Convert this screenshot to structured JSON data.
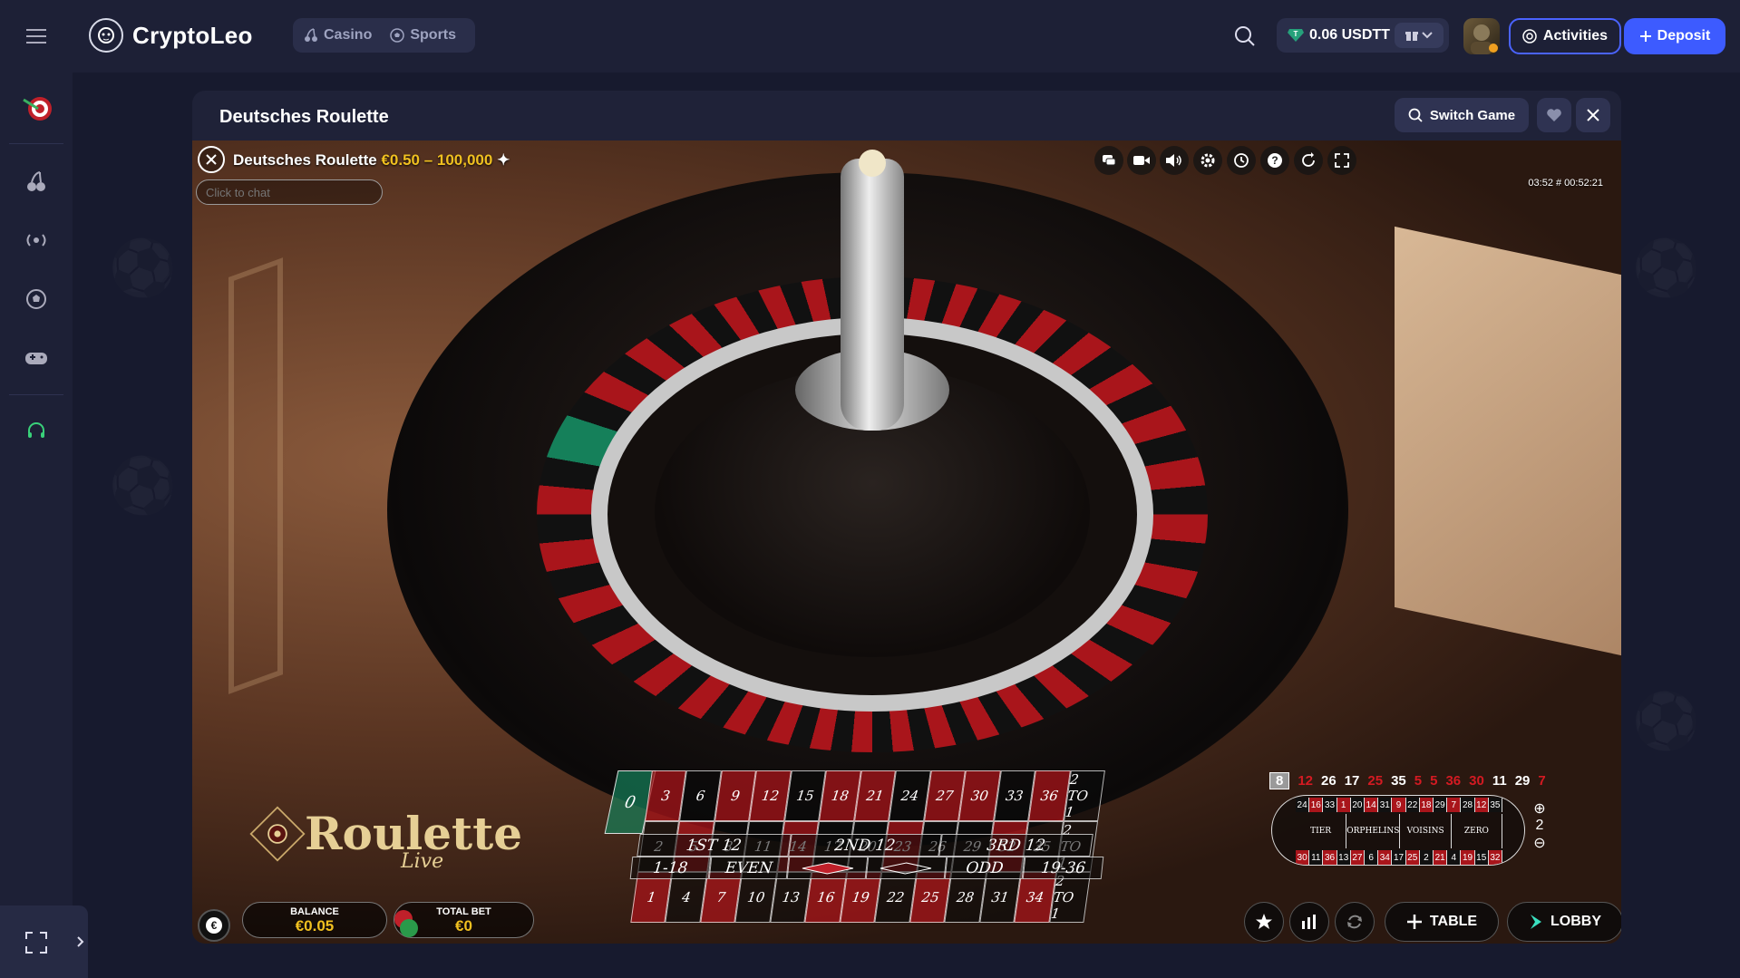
{
  "header": {
    "brand": "CryptoLeo",
    "nav": [
      {
        "label": "Casino"
      },
      {
        "label": "Sports"
      }
    ],
    "wallet": {
      "amount": "0.06 USDTT"
    },
    "activities_label": "Activities",
    "deposit_label": "Deposit"
  },
  "game": {
    "frame_title": "Deutsches Roulette",
    "switch_label": "Switch Game",
    "video_title": "Deutsches Roulette",
    "limits": "€0.50 – 100,000",
    "chat_placeholder": "Click to chat",
    "time": "03:52  # 00:52:21",
    "brand_main": "Roulette",
    "brand_sub": "Live",
    "board": {
      "zero": "0",
      "rows": [
        [
          "3",
          "6",
          "9",
          "12",
          "15",
          "18",
          "21",
          "24",
          "27",
          "30",
          "33",
          "36",
          "2 TO 1"
        ],
        [
          "2",
          "5",
          "8",
          "11",
          "14",
          "17",
          "20",
          "23",
          "26",
          "29",
          "32",
          "35",
          "2 TO 1"
        ],
        [
          "1",
          "4",
          "7",
          "10",
          "13",
          "16",
          "19",
          "22",
          "25",
          "28",
          "31",
          "34",
          "2 TO 1"
        ]
      ],
      "dozens": [
        "1ST 12",
        "2ND 12",
        "3RD 12"
      ],
      "outside": [
        "1-18",
        "EVEN",
        "",
        "",
        "ODD",
        "19-36"
      ]
    },
    "history": [
      "8",
      "12",
      "26",
      "17",
      "25",
      "35",
      "5",
      "5",
      "36",
      "30",
      "11",
      "29",
      "7"
    ],
    "racetrack": {
      "top": [
        "24",
        "16",
        "33",
        "1",
        "20",
        "14",
        "31",
        "9",
        "22",
        "18",
        "29",
        "7",
        "28",
        "12",
        "35"
      ],
      "bottom": [
        "30",
        "11",
        "36",
        "13",
        "27",
        "6",
        "34",
        "17",
        "25",
        "2",
        "21",
        "4",
        "19",
        "15",
        "32"
      ],
      "left": [
        "5",
        "10",
        "23",
        "8"
      ],
      "right": [
        "3",
        "26",
        "0"
      ],
      "sections": [
        "TIER",
        "ORPHELINS",
        "VOISINS",
        "ZERO"
      ]
    },
    "zoom_level": "2",
    "balance_label": "BALANCE",
    "balance": "€0.05",
    "total_bet_label": "TOTAL BET",
    "total_bet": "€0",
    "table_label": "TABLE",
    "lobby_label": "LOBBY"
  }
}
